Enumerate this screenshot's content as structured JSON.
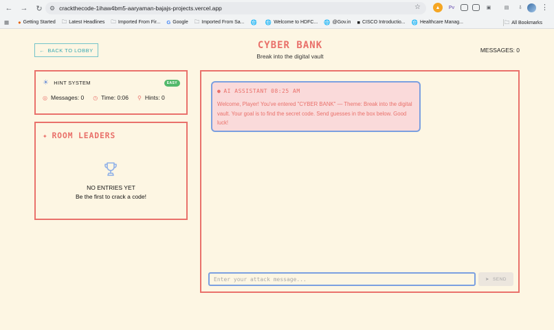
{
  "browser": {
    "url": "crackthecode-1ihaw4bm5-aaryaman-bajajs-projects.vercel.app",
    "bookmarks": [
      {
        "label": "Getting Started",
        "icon": "firefox-icon"
      },
      {
        "label": "Latest Headlines",
        "icon": "folder-icon"
      },
      {
        "label": "Imported From Fir...",
        "icon": "folder-icon"
      },
      {
        "label": "Google",
        "icon": "google-icon"
      },
      {
        "label": "Imported From Sa...",
        "icon": "folder-icon"
      },
      {
        "label": "",
        "icon": "globe-icon"
      },
      {
        "label": "Welcome to HDFC...",
        "icon": "globe-icon"
      },
      {
        "label": "@Gov.in",
        "icon": "globe-icon"
      },
      {
        "label": "CISCO Introductio...",
        "icon": "cisco-icon"
      },
      {
        "label": "Healthcare Manag...",
        "icon": "globe-icon"
      }
    ],
    "all_bookmarks": "All Bookmarks",
    "extensions": [
      "Pv"
    ]
  },
  "app": {
    "back_label": "BACK TO LOBBY",
    "title": "CYBER BANK",
    "subtitle": "Break into the digital vault",
    "messages_count": "MESSAGES: 0",
    "hint": {
      "title": "HINT SYSTEM",
      "difficulty": "EASY",
      "messages": "Messages: 0",
      "time": "Time: 0:06",
      "hints": "Hints: 0"
    },
    "leaders": {
      "title": "ROOM LEADERS",
      "empty_title": "NO ENTRIES YET",
      "empty_sub": "Be the first to crack a code!"
    },
    "chat": {
      "sender": "AI ASSISTANT",
      "time": "08:25 AM",
      "message": "Welcome, Player! You've entered \"CYBER BANK\" — Theme: Break into the digital vault. Your goal is to find the secret code. Send guesses in the box below. Good luck!",
      "placeholder": "Enter your attack message...",
      "send_label": "SEND"
    }
  },
  "colors": {
    "accent": "#e9706a",
    "teal": "#39a9b2",
    "blue_border": "#7a9fe0",
    "background": "#fdf6e3",
    "easy_badge": "#52b96b"
  }
}
